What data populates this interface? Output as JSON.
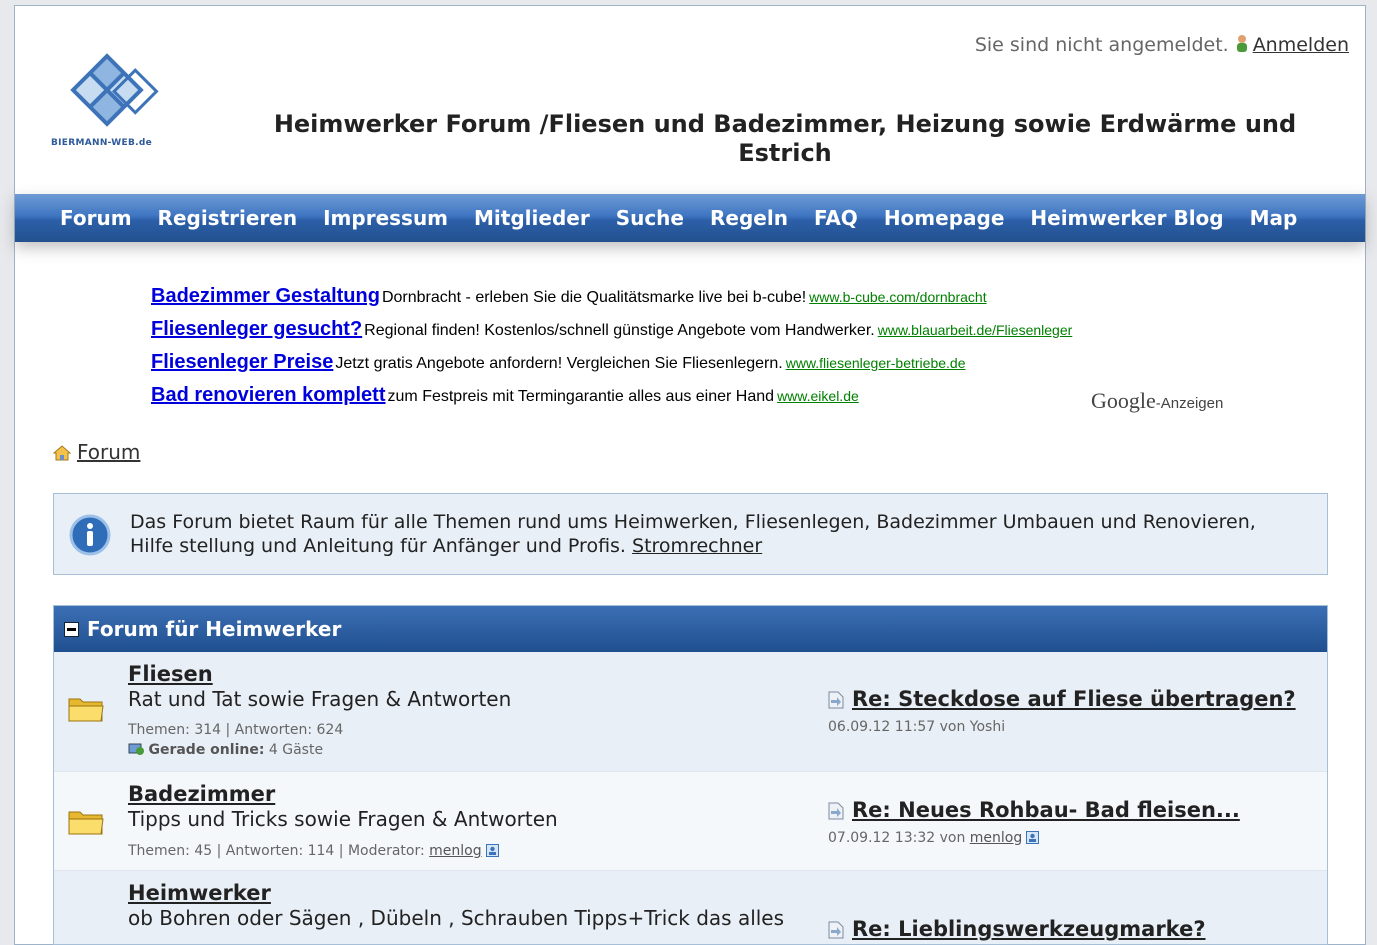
{
  "header": {
    "login_status": "Sie sind nicht angemeldet.",
    "login_link": "Anmelden",
    "site_title": "Heimwerker Forum /Fliesen und Badezimmer, Heizung sowie Erdwärme und Estrich",
    "logo_text": "BIERMANN-WEB.de"
  },
  "nav": {
    "items": [
      "Forum",
      "Registrieren",
      "Impressum",
      "Mitglieder",
      "Suche",
      "Regeln",
      "FAQ",
      "Homepage",
      "Heimwerker Blog",
      "Map"
    ]
  },
  "ads": {
    "items": [
      {
        "title": "Badezimmer Gestaltung",
        "desc": "Dornbracht - erleben Sie die Qualitätsmarke live bei b-cube!",
        "url": "www.b-cube.com/dornbracht"
      },
      {
        "title": "Fliesenleger gesucht?",
        "desc": "Regional finden! Kostenlos/schnell günstige Angebote vom Handwerker.",
        "url": "www.blauarbeit.de/Fliesenleger"
      },
      {
        "title": "Fliesenleger Preise",
        "desc": "Jetzt gratis Angebote anfordern! Vergleichen Sie Fliesenlegern.",
        "url": "www.fliesenleger-betriebe.de"
      },
      {
        "title": "Bad renovieren komplett",
        "desc": "zum Festpreis mit Termingarantie alles aus einer Hand",
        "url": "www.eikel.de"
      }
    ],
    "google_brand": "Google",
    "google_suffix": "-Anzeigen"
  },
  "breadcrumb": {
    "label": "Forum"
  },
  "info": {
    "text": "Das Forum bietet Raum für alle Themen rund ums Heimwerken, Fliesenlegen, Badezimmer Umbauen und Renovieren, Hilfe stellung und Anleitung für Anfänger und Profis.",
    "link": "Stromrechner"
  },
  "forum": {
    "section_title": "Forum für Heimwerker",
    "rows": [
      {
        "name": "Fliesen",
        "desc": "Rat und Tat sowie Fragen & Antworten",
        "stats": "Themen: 314 | Antworten: 624",
        "online_label": "Gerade online:",
        "online_value": "4 Gäste",
        "last_title": "Re: Steckdose auf Fliese übertragen?",
        "last_meta": "06.09.12 11:57 von Yoshi"
      },
      {
        "name": "Badezimmer",
        "desc": "Tipps und Tricks sowie Fragen & Antworten",
        "stats": "Themen: 45 | Antworten: 114 | Moderator:",
        "moderator": "menlog",
        "last_title": "Re: Neues Rohbau- Bad fleisen...",
        "last_meta": "07.09.12 13:32 von",
        "last_user": "menlog"
      },
      {
        "name": "Heimwerker",
        "desc": "ob Bohren oder Sägen , Dübeln , Schrauben Tipps+Trick das alles",
        "last_title": "Re: Lieblingswerkzeugmarke?"
      }
    ]
  },
  "colors": {
    "nav_blue": "#3f76c2",
    "ad_title": "#0000dd",
    "ad_url": "#008000",
    "section_head": "#2a5a9c"
  }
}
